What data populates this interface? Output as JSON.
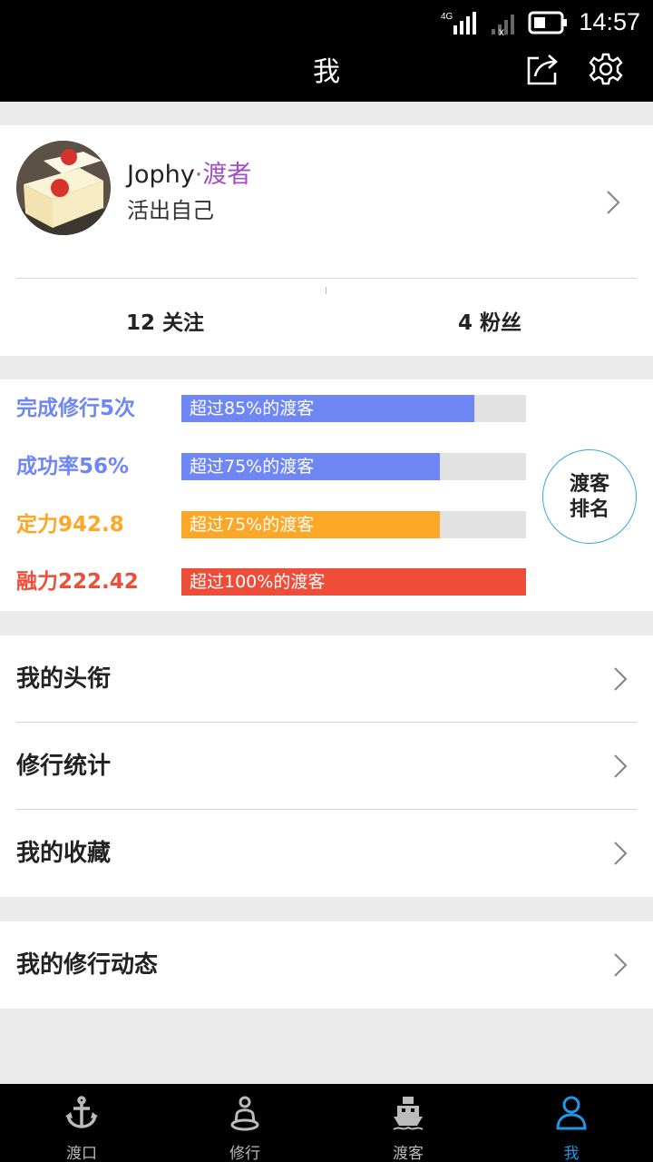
{
  "status_bar": {
    "time": "14:57",
    "network": "4G"
  },
  "navbar": {
    "title": "我",
    "share_icon": "share-icon",
    "settings_icon": "gear-icon"
  },
  "profile": {
    "name": "Jophy",
    "role": "·渡者",
    "motto": "活出自己",
    "stats": {
      "follow": "12 关注",
      "fans": "4 粉丝"
    }
  },
  "ranking": {
    "rows": [
      {
        "label": "完成修行5次",
        "bar_text": "超过85%的渡客",
        "percent": 85,
        "color": "#6e87f5",
        "label_color": "#6e87f5"
      },
      {
        "label": "成功率56%",
        "bar_text": "超过75%的渡客",
        "percent": 75,
        "color": "#6e87f5",
        "label_color": "#6e87f5"
      },
      {
        "label": "定力942.8",
        "bar_text": "超过75%的渡客",
        "percent": 75,
        "color": "#fca726",
        "label_color": "#fca726"
      },
      {
        "label": "融力222.42",
        "bar_text": "超过100%的渡客",
        "percent": 100,
        "color": "#ee4d3a",
        "label_color": "#ee4d3a"
      }
    ],
    "button_line1": "渡客",
    "button_line2": "排名",
    "button_border_color": "#3aa8e0"
  },
  "menu": {
    "items": [
      {
        "label": "我的头衔"
      },
      {
        "label": "修行统计"
      },
      {
        "label": "我的收藏"
      }
    ],
    "items2": [
      {
        "label": "我的修行动态"
      }
    ]
  },
  "tabbar": {
    "tabs": [
      {
        "label": "渡口",
        "icon": "anchor-icon"
      },
      {
        "label": "修行",
        "icon": "meditation-icon"
      },
      {
        "label": "渡客",
        "icon": "boat-icon"
      },
      {
        "label": "我",
        "icon": "person-icon"
      }
    ],
    "active_index": 3,
    "active_color": "#2196e6"
  }
}
